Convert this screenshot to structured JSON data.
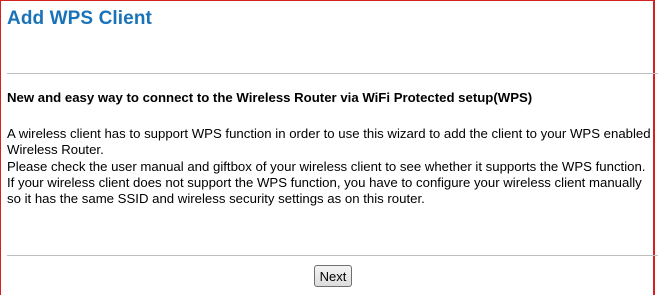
{
  "page": {
    "title": "Add WPS Client",
    "heading": "New and easy way to connect to the Wireless Router via WiFi Protected setup(WPS)",
    "description": [
      "A wireless client has to support WPS function in order to use this wizard to add the client to your WPS enabled Wireless Router.",
      "Please check the user manual and giftbox of your wireless client to see whether it supports the WPS function.",
      "If your wireless client does not support the WPS function, you have to configure your wireless client manually so it has the same SSID and wireless security settings as on this router."
    ]
  },
  "actions": {
    "next_label": "Next"
  },
  "colors": {
    "title": "#1a73b8",
    "frame_border": "#d32020",
    "divider": "#bfbfbf"
  }
}
